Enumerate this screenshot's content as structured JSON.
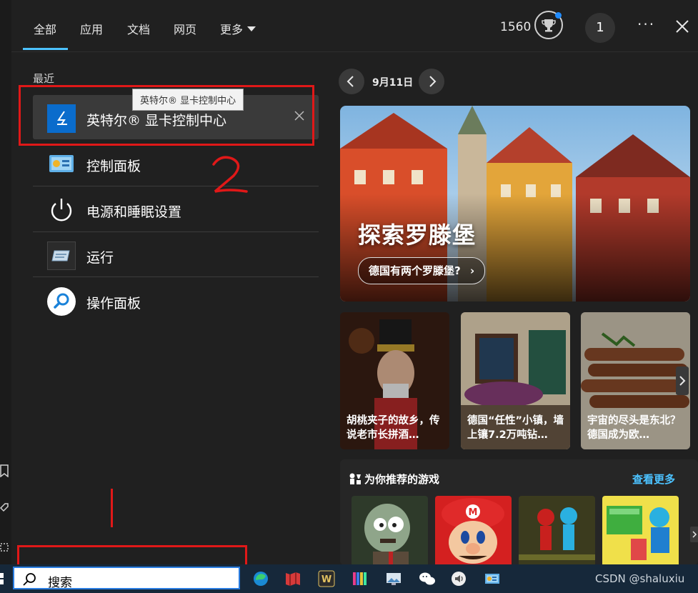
{
  "header": {
    "tabs": [
      {
        "label": "全部",
        "active": true
      },
      {
        "label": "应用"
      },
      {
        "label": "文档"
      },
      {
        "label": "网页"
      },
      {
        "label": "更多"
      }
    ],
    "points": "1560",
    "notification_count": "1"
  },
  "recent": {
    "section_label": "最近",
    "items": [
      {
        "label": "英特尔® 显卡控制中心",
        "icon": "intel-graphics-icon",
        "selected": true
      },
      {
        "label": "控制面板",
        "icon": "control-panel-icon"
      },
      {
        "label": "电源和睡眠设置",
        "icon": "power-icon"
      },
      {
        "label": "运行",
        "icon": "run-icon"
      },
      {
        "label": "操作面板",
        "icon": "search-circle-icon"
      }
    ],
    "tooltip": "英特尔® 显卡控制中心"
  },
  "daily": {
    "date": "9月11日",
    "hero_title": "探索罗滕堡",
    "hero_link": "德国有两个罗滕堡?",
    "cards": [
      {
        "text": "胡桃夹子的故乡，传说老市长拼酒…"
      },
      {
        "text": "德国“任性”小镇，墙上镶7.2万吨钻…"
      },
      {
        "text": "宇宙的尽头是东北？德国成为欧…"
      }
    ]
  },
  "games": {
    "title": "为你推荐的游戏",
    "more_label": "查看更多"
  },
  "annotations": {
    "step_number": "2"
  },
  "taskbar": {
    "search_placeholder": "搜索",
    "watermark": "CSDN @shaluxiu",
    "colors": {
      "annotation": "#e01818",
      "accent": "#4cc2ff"
    }
  }
}
